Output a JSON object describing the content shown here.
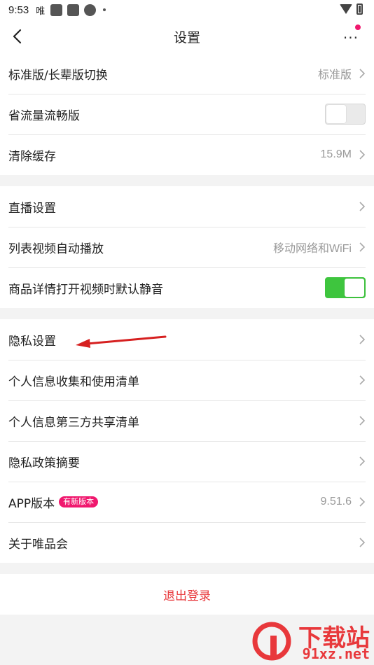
{
  "status_bar": {
    "time": "9:53",
    "app_label": "唯"
  },
  "nav": {
    "title": "设置",
    "more_glyph": "···"
  },
  "group1": [
    {
      "label": "标准版/长辈版切换",
      "value": "标准版"
    },
    {
      "label": "省流量流畅版",
      "toggle": "off"
    },
    {
      "label": "清除缓存",
      "value": "15.9M"
    }
  ],
  "group2": [
    {
      "label": "直播设置"
    },
    {
      "label": "列表视频自动播放",
      "value": "移动网络和WiFi"
    },
    {
      "label": "商品详情打开视频时默认静音",
      "toggle": "on"
    }
  ],
  "group3": [
    {
      "label": "隐私设置"
    },
    {
      "label": "个人信息收集和使用清单"
    },
    {
      "label": "个人信息第三方共享清单"
    },
    {
      "label": "隐私政策摘要"
    },
    {
      "label": "APP版本",
      "badge": "有新版本",
      "value": "9.51.6"
    },
    {
      "label": "关于唯品会"
    }
  ],
  "logout_label": "退出登录",
  "watermark": {
    "title": "下载站",
    "url": "91xz.net"
  },
  "colors": {
    "accent_pink": "#f0186e",
    "toggle_on": "#3ec53e",
    "logout_red": "#e8383b",
    "annotation_arrow": "#d62020"
  }
}
